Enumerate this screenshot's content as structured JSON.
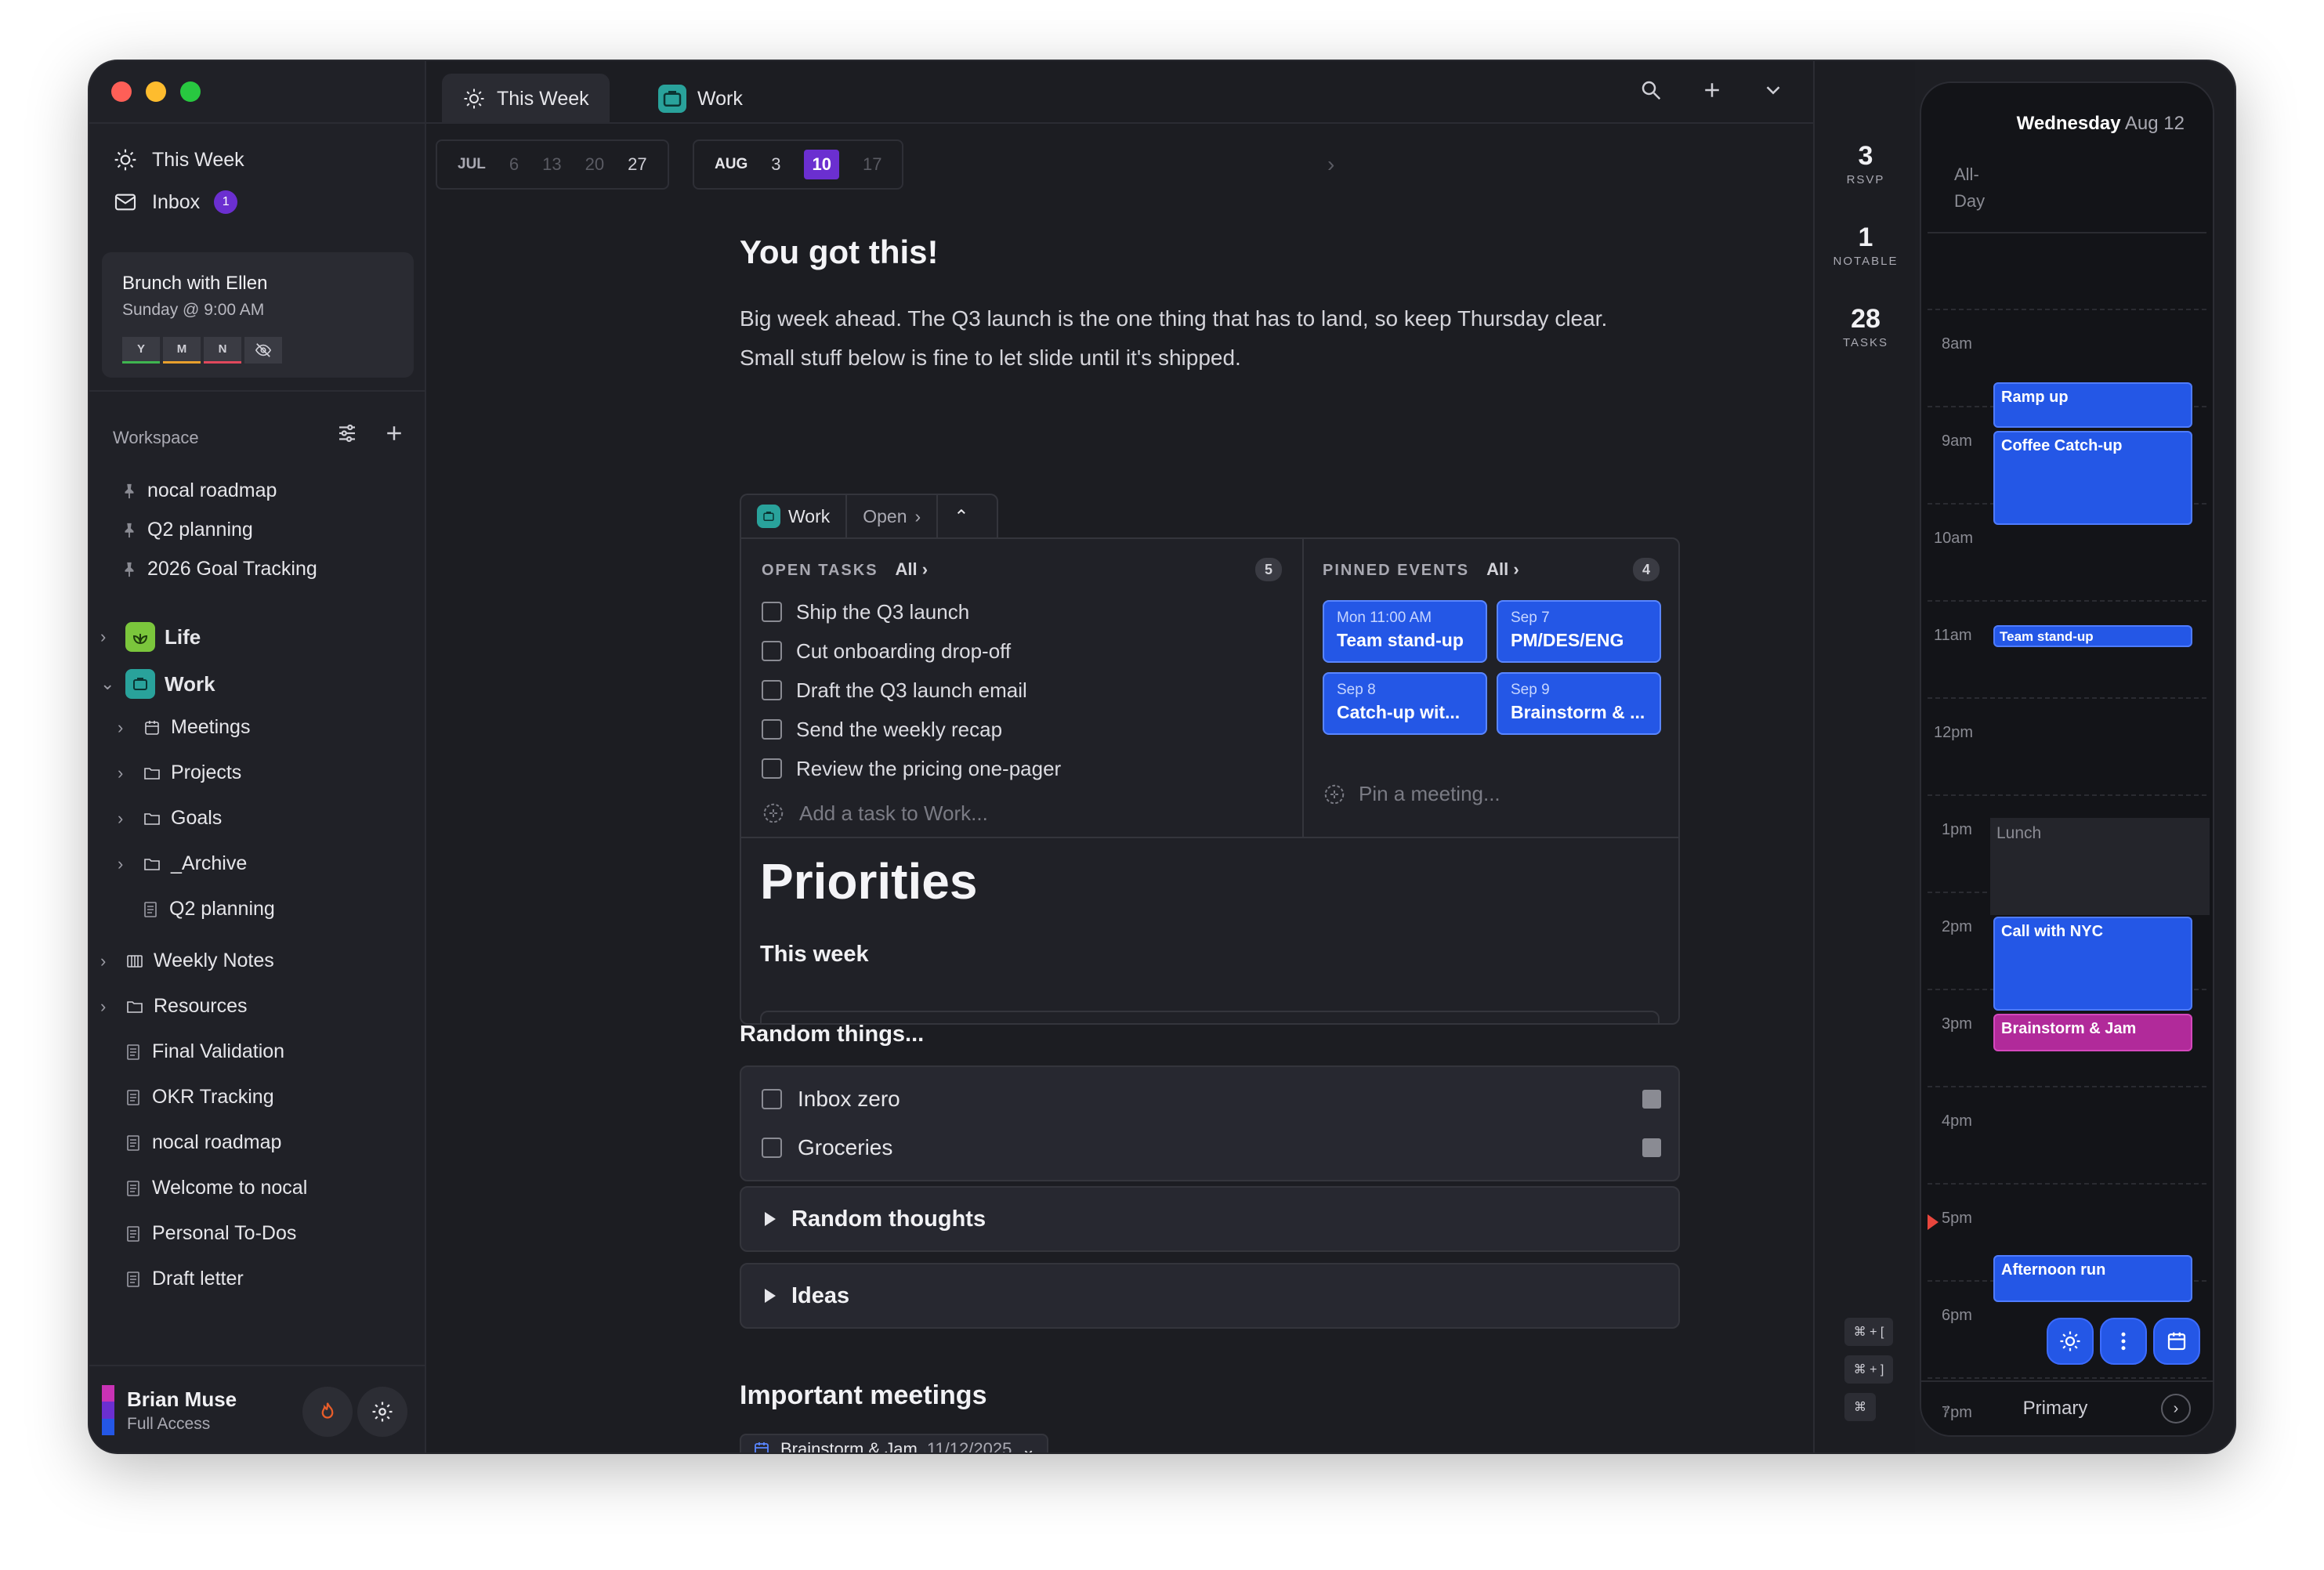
{
  "sidebar": {
    "nav": [
      {
        "label": "This Week"
      },
      {
        "label": "Inbox",
        "badge": "1"
      }
    ],
    "event_card": {
      "title": "Brunch with Ellen",
      "when": "Sunday @ 9:00 AM",
      "rsvp": [
        "Y",
        "M",
        "N"
      ]
    },
    "workspace_label": "Workspace",
    "pinned": [
      "nocal roadmap",
      "Q2 planning",
      "2026 Goal Tracking"
    ],
    "spaces": [
      {
        "label": "Life"
      },
      {
        "label": "Work"
      }
    ],
    "work_children": [
      {
        "label": "Meetings",
        "icon": "calendar-icon"
      },
      {
        "label": "Projects",
        "icon": "folder-icon"
      },
      {
        "label": "Goals",
        "icon": "folder-icon"
      },
      {
        "label": "_Archive",
        "icon": "folder-icon"
      },
      {
        "label": "Q2 planning",
        "icon": "doc-icon"
      }
    ],
    "other": [
      {
        "label": "Weekly Notes",
        "icon": "columns-icon"
      },
      {
        "label": "Resources",
        "icon": "folder-icon"
      },
      {
        "label": "Final Validation",
        "icon": "doc-icon"
      },
      {
        "label": "OKR Tracking",
        "icon": "doc-icon"
      },
      {
        "label": "nocal roadmap",
        "icon": "doc-icon"
      },
      {
        "label": "Welcome to nocal",
        "icon": "doc-icon"
      },
      {
        "label": "Personal To-Dos",
        "icon": "doc-icon"
      },
      {
        "label": "Draft letter",
        "icon": "doc-icon"
      }
    ],
    "user": {
      "name": "Brian Muse",
      "role": "Full Access",
      "flag_colors": [
        "#c832b4",
        "#6b2fd0",
        "#2457e6"
      ]
    }
  },
  "tabs": [
    {
      "label": "This Week",
      "active": true
    },
    {
      "label": "Work",
      "active": false
    }
  ],
  "datebar": {
    "jul": {
      "month": "JUL",
      "days": [
        "6",
        "13",
        "20",
        "27"
      ]
    },
    "aug": {
      "month": "AUG",
      "days": [
        "3",
        "10",
        "17"
      ],
      "selected": "10"
    }
  },
  "content": {
    "headline": "You got this!",
    "intro_1": "Big week ahead. The Q3 launch is the one thing that has to land, so keep Thursday clear.",
    "intro_2": "Small stuff below is fine to let slide until it's shipped."
  },
  "panel": {
    "tab_work": "Work",
    "tab_open": "Open",
    "open_tasks_label": "OPEN TASKS",
    "all_label": "All",
    "open_tasks_count": "5",
    "tasks": [
      "Ship the Q3 launch",
      "Cut onboarding drop-off",
      "Draft the Q3 launch email",
      "Send the weekly recap",
      "Review the pricing one-pager"
    ],
    "add_task": "Add a task to Work...",
    "pinned_events_label": "PINNED EVENTS",
    "pinned_count": "4",
    "pinned_events": [
      {
        "time": "Mon 11:00 AM",
        "name": "Team stand-up"
      },
      {
        "time": "Sep 7",
        "name": "PM/DES/ENG"
      },
      {
        "time": "Sep 8",
        "name": "Catch-up wit..."
      },
      {
        "time": "Sep 9",
        "name": "Brainstorm & ..."
      }
    ],
    "pin_meeting": "Pin a meeting...",
    "priorities_title": "Priorities",
    "priorities_sub": "This week"
  },
  "random": {
    "title": "Random things...",
    "items": [
      "Inbox zero",
      "Groceries"
    ]
  },
  "toggles": [
    "Random thoughts",
    "Ideas"
  ],
  "meetings": {
    "title": "Important meetings",
    "chip_name": "Brainstorm & Jam",
    "chip_date": "11/12/2025"
  },
  "stats": [
    {
      "value": "3",
      "label": "RSVP"
    },
    {
      "value": "1",
      "label": "NOTABLE"
    },
    {
      "value": "28",
      "label": "TASKS"
    }
  ],
  "shortcuts": [
    "⌘ + [",
    "⌘ + ]",
    "⌘"
  ],
  "calendar": {
    "day": "Wednesday",
    "date": "Aug 12",
    "allday": [
      "All-",
      "Day"
    ],
    "hours": [
      "8am",
      "9am",
      "10am",
      "11am",
      "12pm",
      "1pm",
      "2pm",
      "3pm",
      "4pm",
      "5pm",
      "6pm",
      "7pm"
    ],
    "events": [
      "Ramp up",
      "Coffee Catch-up",
      "Team stand-up",
      "Lunch",
      "Call with NYC",
      "Brainstorm & Jam",
      "Afternoon run"
    ],
    "footer": "Primary"
  },
  "colors": {
    "accent_purple": "#6b2fd0",
    "event_blue": "#2457e6",
    "event_magenta": "#b12a9a",
    "work_teal": "#29a29b",
    "life_green": "#7bc63c"
  }
}
